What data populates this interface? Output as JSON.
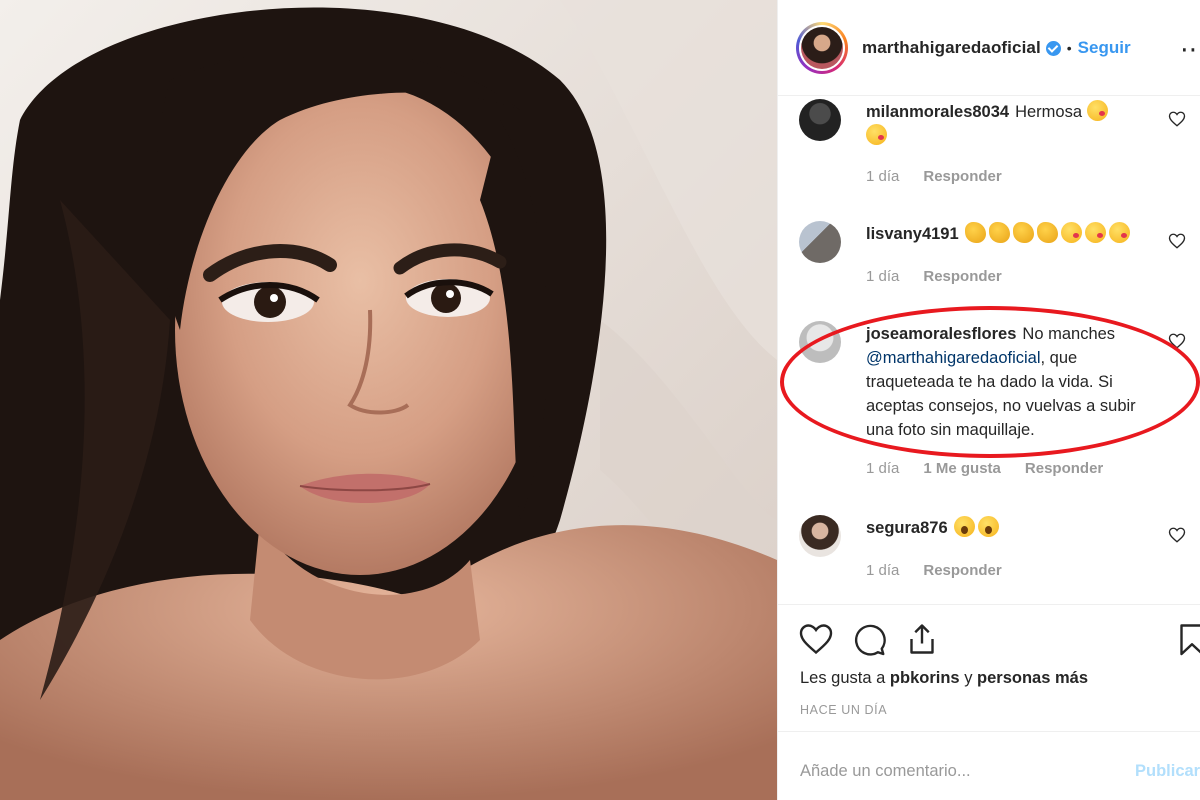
{
  "post": {
    "username": "marthahigaredaoficial",
    "separator": "•",
    "follow_label": "Seguir",
    "more_icon": "more-options-icon"
  },
  "comments": [
    {
      "user": "milanmorales8034",
      "text_lines": [
        "Hermosa"
      ],
      "emojis_line1": [
        "kiss"
      ],
      "emojis_line2": [
        "kiss"
      ],
      "time": "1 día",
      "likes": "",
      "reply": "Responder"
    },
    {
      "user": "lisvany4191",
      "text_lines": [
        ""
      ],
      "emojis_line1": [
        "clap",
        "clap",
        "clap",
        "clap",
        "kiss",
        "kiss",
        "kiss"
      ],
      "time": "1 día",
      "likes": "",
      "reply": "Responder"
    },
    {
      "user": "joseamoralesflores",
      "text_first": "No manches",
      "mention": "@marthahigaredaoficial",
      "text_rest": ", que traqueteada te ha dado la vida. Si aceptas consejos, no vuelvas a subir una foto sin maquillaje.",
      "time": "1 día",
      "likes": "1 Me gusta",
      "reply": "Responder"
    },
    {
      "user": "segura876",
      "text_lines": [
        ""
      ],
      "emojis_line1": [
        "wow",
        "wow"
      ],
      "time": "1 día",
      "likes": "",
      "reply": "Responder"
    }
  ],
  "actions": {
    "likes_prefix": "Les gusta a",
    "likes_user": "pbkorins",
    "likes_middle": "y",
    "likes_suffix": "personas más",
    "time_ago": "HACE UN DÍA"
  },
  "composer": {
    "placeholder": "Añade un comentario...",
    "post_label": "Publicar"
  },
  "annotation": {
    "color": "#e8191f"
  },
  "colors": {
    "accent": "#3897f0",
    "muted": "#999999",
    "text": "#262626"
  }
}
